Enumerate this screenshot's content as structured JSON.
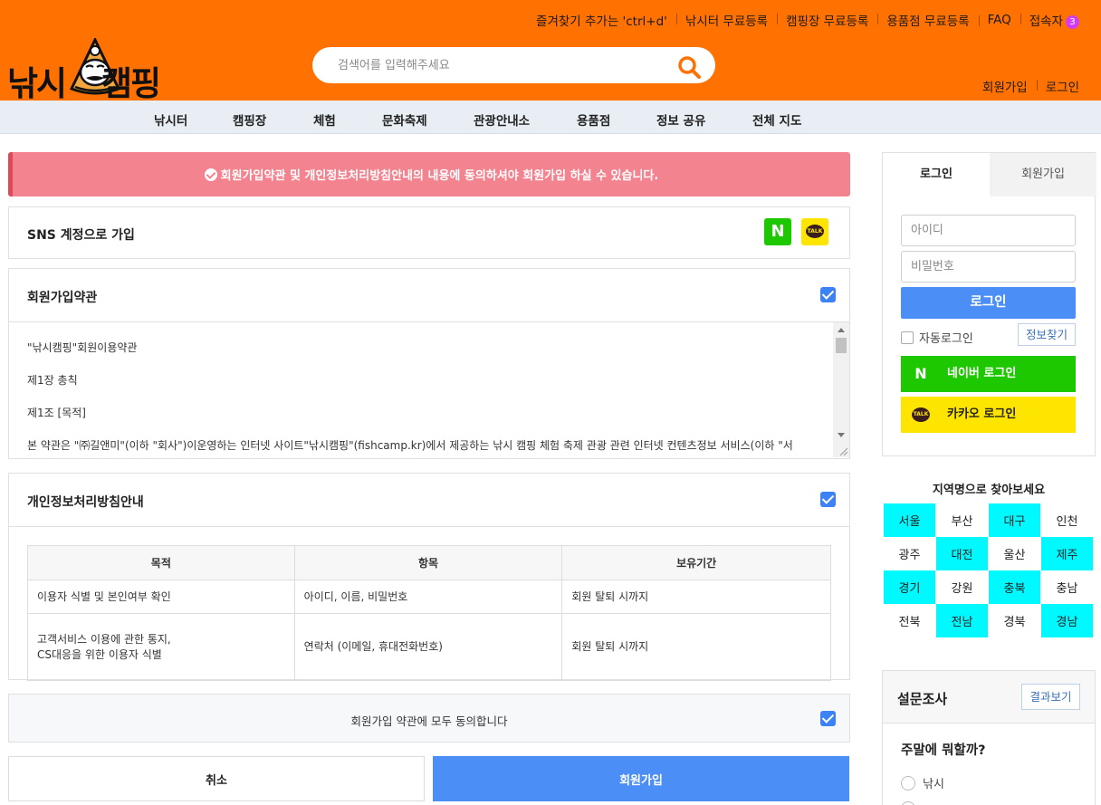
{
  "header": {
    "top_links": [
      "즐겨찾기 추가는 'ctrl+d'",
      "낚시터 무료등록",
      "캠핑장 무료등록",
      "용품점 무료등록",
      "FAQ",
      "접속자"
    ],
    "visitor_count": "3",
    "logo_text_left": "낚시",
    "logo_text_right": "캠핑",
    "search_placeholder": "검색어를 입력해주세요",
    "auth_links": [
      "회원가입",
      "로그인"
    ]
  },
  "nav": [
    "낚시터",
    "캠핑장",
    "체험",
    "문화축제",
    "관광안내소",
    "용품점",
    "정보 공유",
    "전체 지도"
  ],
  "notice": "회원가입약관 및 개인정보처리방침안내의 내용에 동의하셔야 회원가입 하실 수 있습니다.",
  "sns": {
    "title": "SNS 계정으로 가입",
    "naver_label": "N",
    "kakao_label": "TALK"
  },
  "terms": {
    "title": "회원가입약관",
    "lines": [
      "\"낚시캠핑\"회원이용약관",
      "제1장 총칙",
      "제1조 [목적]",
      "본 약관은 \"㈜길앤미\"(이하 \"회사\")이운영하는 인터넷 사이트\"낚시캠핑\"(fishcamp.kr)에서 제공하는 낚시 캠핑 체험 축제 관광 관련 인터넷 컨텐츠정보 서비스(이하 \"서"
    ]
  },
  "privacy": {
    "title": "개인정보처리방침안내",
    "headers": [
      "목적",
      "항목",
      "보유기간"
    ],
    "rows": [
      {
        "purpose": "이용자 식별 및 본인여부 확인",
        "item": "아이디, 이름, 비밀번호",
        "period": "회원 탈퇴 시까지"
      },
      {
        "purpose_line1": "고객서비스 이용에 관한 통지,",
        "purpose_line2": "CS대응을 위한 이용자 식별",
        "item": "연락처 (이메일, 휴대전화번호)",
        "period": "회원 탈퇴 시까지"
      }
    ]
  },
  "agree_all": "회원가입 약관에 모두 동의합니다",
  "buttons": {
    "cancel": "취소",
    "join": "회원가입"
  },
  "login": {
    "tab_login": "로그인",
    "tab_join": "회원가입",
    "id_placeholder": "아이디",
    "pw_placeholder": "비밀번호",
    "login_button": "로그인",
    "auto_login": "자동로그인",
    "find_info": "정보찾기",
    "naver_login": "네이버 로그인",
    "kakao_login": "카카오 로그인",
    "naver_icon": "N",
    "kakao_icon": "TALK"
  },
  "region": {
    "title": "지역명으로 찾아보세요",
    "cells": [
      {
        "name": "서울",
        "hl": true
      },
      {
        "name": "부산",
        "hl": false
      },
      {
        "name": "대구",
        "hl": true
      },
      {
        "name": "인천",
        "hl": false
      },
      {
        "name": "광주",
        "hl": false
      },
      {
        "name": "대전",
        "hl": true
      },
      {
        "name": "울산",
        "hl": false
      },
      {
        "name": "제주",
        "hl": true
      },
      {
        "name": "경기",
        "hl": true
      },
      {
        "name": "강원",
        "hl": false
      },
      {
        "name": "충북",
        "hl": true
      },
      {
        "name": "충남",
        "hl": false
      },
      {
        "name": "전북",
        "hl": false
      },
      {
        "name": "전남",
        "hl": true
      },
      {
        "name": "경북",
        "hl": false
      },
      {
        "name": "경남",
        "hl": true
      }
    ],
    "highlight_color": "#00f8ff"
  },
  "survey": {
    "title": "설문조사",
    "result_button": "결과보기",
    "question": "주말에 뭐할까?",
    "options": [
      "낚시"
    ]
  },
  "colors": {
    "brand_orange": "#ff7100",
    "primary_blue": "#4b8ef5",
    "notice_pink": "#f3838f",
    "naver_green": "#1ec800",
    "kakao_yellow": "#fee500"
  }
}
